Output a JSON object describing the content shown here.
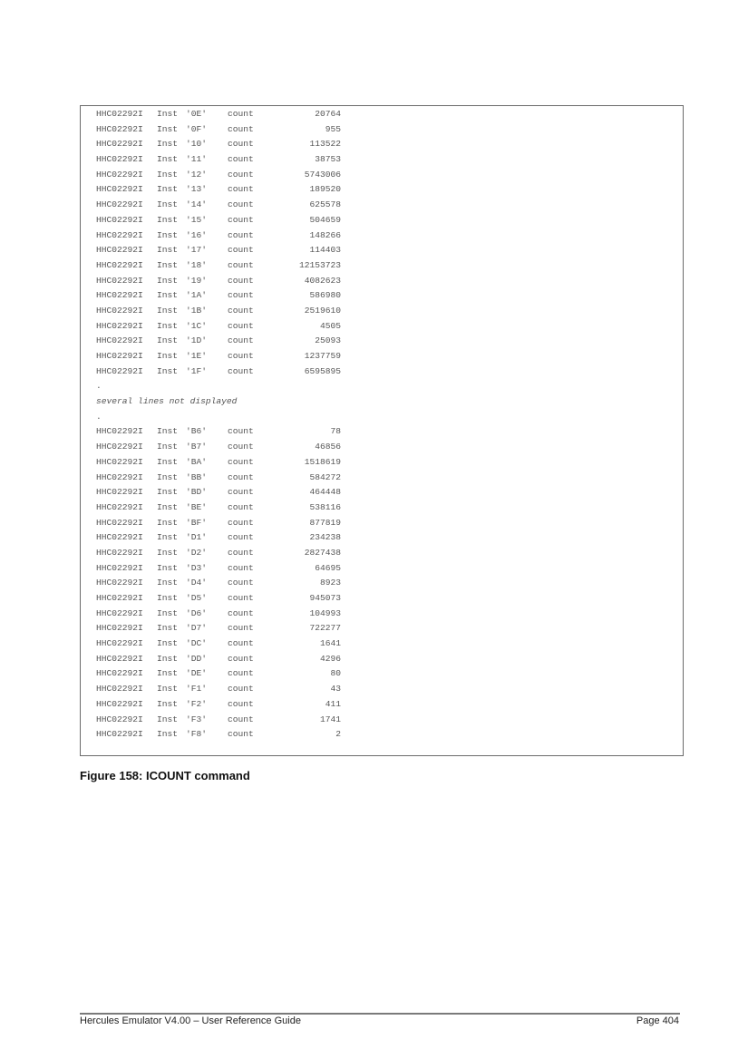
{
  "figure": {
    "rows": [
      {
        "msg": "HHC02292I",
        "inst": "Inst",
        "op": "'0E'",
        "label": "count",
        "value": "20764"
      },
      {
        "msg": "HHC02292I",
        "inst": "Inst",
        "op": "'0F'",
        "label": "count",
        "value": "955"
      },
      {
        "msg": "HHC02292I",
        "inst": "Inst",
        "op": "'10'",
        "label": "count",
        "value": "113522"
      },
      {
        "msg": "HHC02292I",
        "inst": "Inst",
        "op": "'11'",
        "label": "count",
        "value": "38753"
      },
      {
        "msg": "HHC02292I",
        "inst": "Inst",
        "op": "'12'",
        "label": "count",
        "value": "5743006"
      },
      {
        "msg": "HHC02292I",
        "inst": "Inst",
        "op": "'13'",
        "label": "count",
        "value": "189520"
      },
      {
        "msg": "HHC02292I",
        "inst": "Inst",
        "op": "'14'",
        "label": "count",
        "value": "625578"
      },
      {
        "msg": "HHC02292I",
        "inst": "Inst",
        "op": "'15'",
        "label": "count",
        "value": "504659"
      },
      {
        "msg": "HHC02292I",
        "inst": "Inst",
        "op": "'16'",
        "label": "count",
        "value": "148266"
      },
      {
        "msg": "HHC02292I",
        "inst": "Inst",
        "op": "'17'",
        "label": "count",
        "value": "114403"
      },
      {
        "msg": "HHC02292I",
        "inst": "Inst",
        "op": "'18'",
        "label": "count",
        "value": "12153723"
      },
      {
        "msg": "HHC02292I",
        "inst": "Inst",
        "op": "'19'",
        "label": "count",
        "value": "4082623"
      },
      {
        "msg": "HHC02292I",
        "inst": "Inst",
        "op": "'1A'",
        "label": "count",
        "value": "586980"
      },
      {
        "msg": "HHC02292I",
        "inst": "Inst",
        "op": "'1B'",
        "label": "count",
        "value": "2519610"
      },
      {
        "msg": "HHC02292I",
        "inst": "Inst",
        "op": "'1C'",
        "label": "count",
        "value": "4505"
      },
      {
        "msg": "HHC02292I",
        "inst": "Inst",
        "op": "'1D'",
        "label": "count",
        "value": "25093"
      },
      {
        "msg": "HHC02292I",
        "inst": "Inst",
        "op": "'1E'",
        "label": "count",
        "value": "1237759"
      },
      {
        "msg": "HHC02292I",
        "inst": "Inst",
        "op": "'1F'",
        "label": "count",
        "value": "6595895"
      }
    ],
    "ellipsis_top": ".",
    "omitted_note": "several lines not displayed",
    "ellipsis_bottom": ".",
    "rows2": [
      {
        "msg": "HHC02292I",
        "inst": "Inst",
        "op": "'B6'",
        "label": "count",
        "value": "78"
      },
      {
        "msg": "HHC02292I",
        "inst": "Inst",
        "op": "'B7'",
        "label": "count",
        "value": "46856"
      },
      {
        "msg": "HHC02292I",
        "inst": "Inst",
        "op": "'BA'",
        "label": "count",
        "value": "1518619"
      },
      {
        "msg": "HHC02292I",
        "inst": "Inst",
        "op": "'BB'",
        "label": "count",
        "value": "584272"
      },
      {
        "msg": "HHC02292I",
        "inst": "Inst",
        "op": "'BD'",
        "label": "count",
        "value": "464448"
      },
      {
        "msg": "HHC02292I",
        "inst": "Inst",
        "op": "'BE'",
        "label": "count",
        "value": "538116"
      },
      {
        "msg": "HHC02292I",
        "inst": "Inst",
        "op": "'BF'",
        "label": "count",
        "value": "877819"
      },
      {
        "msg": "HHC02292I",
        "inst": "Inst",
        "op": "'D1'",
        "label": "count",
        "value": "234238"
      },
      {
        "msg": "HHC02292I",
        "inst": "Inst",
        "op": "'D2'",
        "label": "count",
        "value": "2827438"
      },
      {
        "msg": "HHC02292I",
        "inst": "Inst",
        "op": "'D3'",
        "label": "count",
        "value": "64695"
      },
      {
        "msg": "HHC02292I",
        "inst": "Inst",
        "op": "'D4'",
        "label": "count",
        "value": "8923"
      },
      {
        "msg": "HHC02292I",
        "inst": "Inst",
        "op": "'D5'",
        "label": "count",
        "value": "945073"
      },
      {
        "msg": "HHC02292I",
        "inst": "Inst",
        "op": "'D6'",
        "label": "count",
        "value": "104993"
      },
      {
        "msg": "HHC02292I",
        "inst": "Inst",
        "op": "'D7'",
        "label": "count",
        "value": "722277"
      },
      {
        "msg": "HHC02292I",
        "inst": "Inst",
        "op": "'DC'",
        "label": "count",
        "value": "1641"
      },
      {
        "msg": "HHC02292I",
        "inst": "Inst",
        "op": "'DD'",
        "label": "count",
        "value": "4296"
      },
      {
        "msg": "HHC02292I",
        "inst": "Inst",
        "op": "'DE'",
        "label": "count",
        "value": "80"
      },
      {
        "msg": "HHC02292I",
        "inst": "Inst",
        "op": "'F1'",
        "label": "count",
        "value": "43"
      },
      {
        "msg": "HHC02292I",
        "inst": "Inst",
        "op": "'F2'",
        "label": "count",
        "value": "411"
      },
      {
        "msg": "HHC02292I",
        "inst": "Inst",
        "op": "'F3'",
        "label": "count",
        "value": "1741"
      },
      {
        "msg": "HHC02292I",
        "inst": "Inst",
        "op": "'F8'",
        "label": "count",
        "value": "2"
      }
    ],
    "caption": "Figure 158: ICOUNT command"
  },
  "footer": {
    "left": "Hercules Emulator V4.00 – User Reference Guide",
    "right": "Page 404"
  }
}
